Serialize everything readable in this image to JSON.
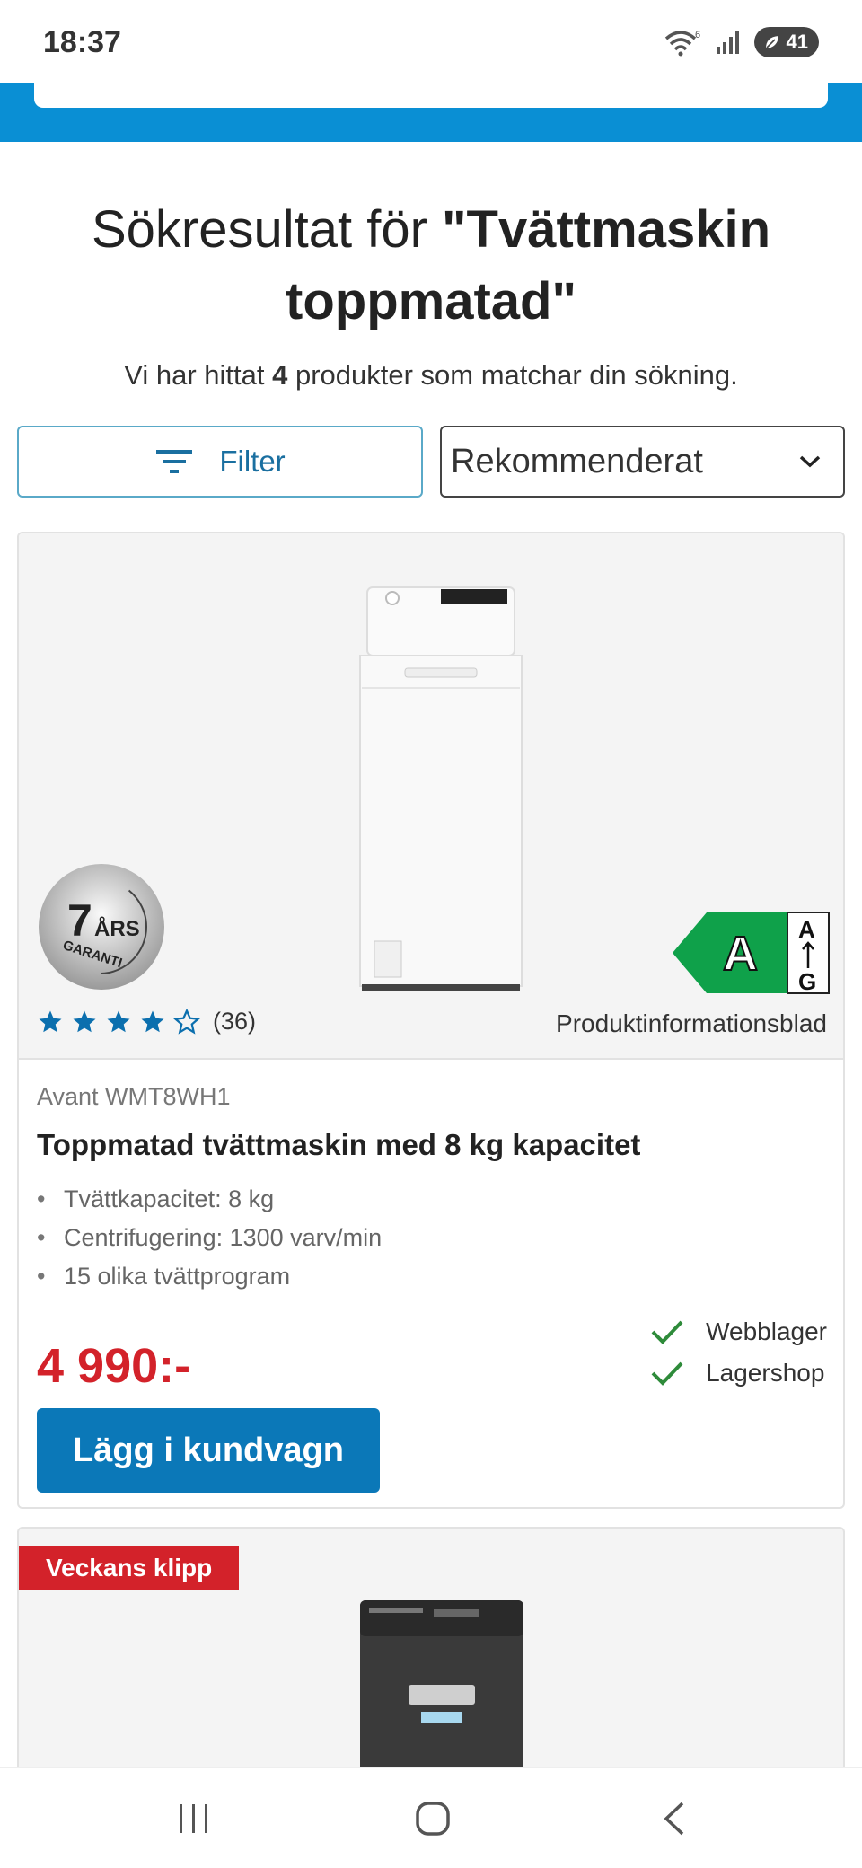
{
  "status_bar": {
    "time": "18:37",
    "wifi_badge": "6",
    "battery": "41"
  },
  "search": {
    "title_prefix": "Sökresultat för ",
    "query_quoted": "\"Tvättmaskin toppmatad\"",
    "result_text_pre": "Vi har hittat ",
    "result_count": "4",
    "result_text_post": " produkter som matchar din sökning."
  },
  "controls": {
    "filter_label": "Filter",
    "sort_selected": "Rekommenderat"
  },
  "products": [
    {
      "garanti_years": "7",
      "garanti_text": "ÅRS",
      "garanti_sub": "GARANTI",
      "energy_class": "A",
      "energy_scale_top": "A",
      "energy_scale_bottom": "G",
      "rating_stars": 4,
      "rating_max": 5,
      "rating_count": "(36)",
      "info_sheet": "Produktinformationsblad",
      "brand_model": "Avant WMT8WH1",
      "title": "Toppmatad tvättmaskin med 8 kg kapacitet",
      "specs": [
        "Tvättkapacitet: 8 kg",
        "Centrifugering: 1300 varv/min",
        "15 olika tvättprogram"
      ],
      "stock": [
        "Webblager",
        "Lagershop"
      ],
      "price": "4 990:-",
      "cart_label": "Lägg i kundvagn"
    },
    {
      "badge": "Veckans klipp"
    }
  ],
  "colors": {
    "accent_blue": "#0a8fd4",
    "button_blue": "#0b78b8",
    "price_red": "#d3222a",
    "energy_green": "#0fa14a",
    "check_green": "#2e8b3a"
  },
  "icons": {
    "nav_recent": "recent-apps-icon",
    "nav_home": "home-icon",
    "nav_back": "back-icon"
  }
}
